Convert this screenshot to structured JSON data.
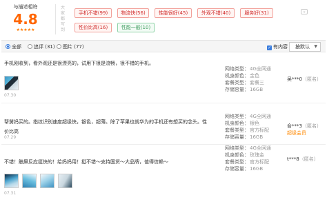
{
  "rating": {
    "label": "与描述相符",
    "score": "4.8",
    "stars": "★★★★★",
    "side_note": "大家都写到"
  },
  "tags": [
    {
      "label": "手机不错(99)",
      "tone": "red"
    },
    {
      "label": "物流快(56)",
      "tone": "red"
    },
    {
      "label": "性能很好(45)",
      "tone": "red"
    },
    {
      "label": "外观不错(40)",
      "tone": "red"
    },
    {
      "label": "服务好(31)",
      "tone": "red"
    },
    {
      "label": "性价比高(16)",
      "tone": "red"
    },
    {
      "label": "性能一般(10)",
      "tone": "green"
    }
  ],
  "expand_icon": "chevron-down-icon",
  "filter": {
    "all": "全部",
    "followup": "追评 (31)",
    "images": "图片 (77)",
    "selected": "all",
    "has_content": "有内容",
    "has_content_checked": true,
    "sort": "按默认"
  },
  "reviews": [
    {
      "text": "手机刚收到，看外观还是很漂亮的，试用下很是流畅，很不错的手机。",
      "images": [
        "img-1"
      ],
      "date": "07.30",
      "specs": [
        {
          "k": "网络类型：",
          "v": "4G全网通"
        },
        {
          "k": "机身颜色：",
          "v": "金色"
        },
        {
          "k": "套餐类型：",
          "v": "套餐三"
        },
        {
          "k": "存储容量：",
          "v": "16GB"
        }
      ],
      "user": "吴***0",
      "anon": "（匿名）",
      "badge": ""
    },
    {
      "text": "帮舅妈买的。指纹识别速度超级快，银色，超薄。除了苹果也就华为的手机还有想买的念头。性价比高",
      "images": [],
      "date": "07.29",
      "specs": [
        {
          "k": "网络类型：",
          "v": "4G全网通"
        },
        {
          "k": "机身颜色：",
          "v": "银色"
        },
        {
          "k": "套餐类型：",
          "v": "官方标配"
        },
        {
          "k": "存储容量：",
          "v": "16GB"
        }
      ],
      "user": "俞***3",
      "anon": "（匿名）",
      "badge": "超级会员"
    },
    {
      "text": "不错！触屏反应挺快的！给妈妈用！挺不错～支持国货～大品牌，值得信赖～",
      "images": [
        "img-2",
        "img-3",
        "img-4",
        "img-5"
      ],
      "date": "07.31",
      "specs": [
        {
          "k": "网络类型：",
          "v": "4G全网通"
        },
        {
          "k": "机身颜色：",
          "v": "玫瑰金"
        },
        {
          "k": "套餐类型：",
          "v": "官方标配"
        },
        {
          "k": "存储容量：",
          "v": "16GB"
        }
      ],
      "user": "t***8",
      "anon": "（匿名）",
      "badge": ""
    }
  ]
}
